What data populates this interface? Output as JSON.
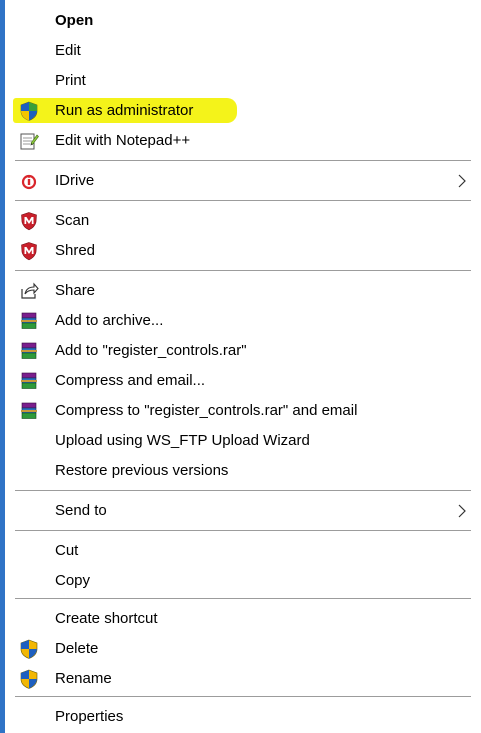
{
  "menu": {
    "colors": {
      "highlight": "#f4f31a",
      "separator": "#9c9c9c",
      "edge": "#2f73c6"
    },
    "items": [
      {
        "label": "Open",
        "bold": true,
        "icon": ""
      },
      {
        "label": "Edit",
        "icon": ""
      },
      {
        "label": "Print",
        "icon": ""
      },
      {
        "label": "Run as administrator",
        "icon": "uac-shield-icon",
        "highlighted": true
      },
      {
        "label": "Edit with Notepad++",
        "icon": "notepad-plus-plus-icon"
      },
      {
        "label": "IDrive",
        "icon": "idrive-icon",
        "submenu": true
      },
      {
        "label": "Scan",
        "icon": "mcafee-icon"
      },
      {
        "label": "Shred",
        "icon": "mcafee-icon"
      },
      {
        "label": "Share",
        "icon": "share-icon"
      },
      {
        "label": "Add to archive...",
        "icon": "winrar-icon"
      },
      {
        "label": "Add to \"register_controls.rar\"",
        "icon": "winrar-icon"
      },
      {
        "label": "Compress and email...",
        "icon": "winrar-icon"
      },
      {
        "label": "Compress to \"register_controls.rar\" and email",
        "icon": "winrar-icon"
      },
      {
        "label": "Upload using WS_FTP Upload Wizard",
        "icon": ""
      },
      {
        "label": "Restore previous versions",
        "icon": ""
      },
      {
        "label": "Send to",
        "icon": "",
        "submenu": true
      },
      {
        "label": "Cut",
        "icon": ""
      },
      {
        "label": "Copy",
        "icon": ""
      },
      {
        "label": "Create shortcut",
        "icon": ""
      },
      {
        "label": "Delete",
        "icon": "uac-shield-icon"
      },
      {
        "label": "Rename",
        "icon": "uac-shield-icon"
      },
      {
        "label": "Properties",
        "icon": ""
      }
    ]
  }
}
